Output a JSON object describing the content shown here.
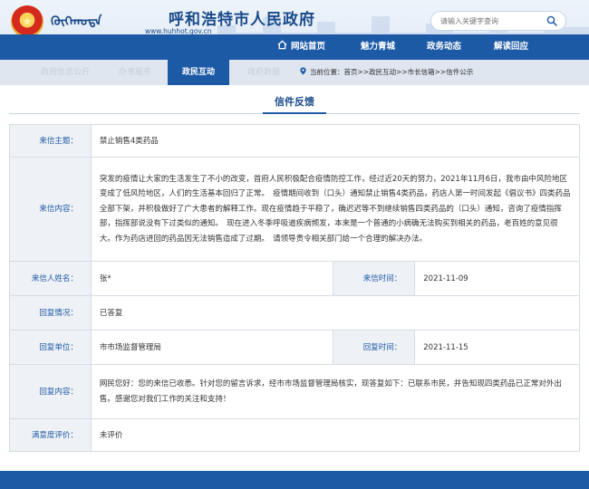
{
  "header": {
    "mongol_script": "ᠬᠥᠬᠡᠬᠣᠲᠠ",
    "site_title": "呼和浩特市人民政府",
    "site_url": "www.huhhot.gov.cn",
    "search_placeholder": "请输入关键字查询",
    "colors": {
      "primary": "#1d5aa6",
      "nav_text": "#ffffff"
    }
  },
  "nav": {
    "items": [
      {
        "label": "网站首页",
        "icon": "home-icon"
      },
      {
        "label": "魅力青城"
      },
      {
        "label": "政务动态"
      },
      {
        "label": "解读回应"
      }
    ]
  },
  "subnav": {
    "tabs": [
      {
        "label": "政府信息公开"
      },
      {
        "label": "办事服务"
      },
      {
        "label": "政民互动"
      },
      {
        "label": "政府数据"
      }
    ],
    "active_index": 2,
    "breadcrumb": "当前位置：首页>>政民互动>>市长信箱>>信件公示"
  },
  "section": {
    "title": "信件反馈"
  },
  "letter": {
    "subject_label": "来信主题：",
    "subject": "禁止销售4类药品",
    "content_label": "来信内容：",
    "content": "突发的疫情让大家的生活发生了不小的改变，首府人民积极配合疫情防控工作，经过近20天的努力，2021年11月6日，我市由中风险地区变成了低风险地区，人们的生活基本回归了正常。　疫情期间收到（口头）通知禁止销售4类药品，药店人第一时间发起《倡议书》四类药品全部下架，并积极做好了广大患者的解释工作。现在疫情趋于平稳了，确迟迟等不到继续销售四类药品的（口头）通知，咨询了疫情指挥部，指挥部说没有下过类似的通知。　现在进入冬季呼吸道疾病频发，本来是一个普通的小病确无法购买到相关的药品，老百姓的意见很大。作为药店进回的药品因无法销售造成了过期。　请领导责令相关部门给一个合理的解决办法。",
    "sender_label": "来信人姓名：",
    "sender": "张*",
    "date_label": "来信时间：",
    "date": "2021-11-09",
    "status_label": "回复情况：",
    "status": "已答复",
    "reply_unit_label": "回复单位：",
    "reply_unit": "市市场监督管理局",
    "reply_date_label": "回复时间：",
    "reply_date": "2021-11-15",
    "reply_label": "回复内容：",
    "reply": "网民您好：您的来信已收悉。针对您的留言诉求，经市市场监督管理局核实，现答复如下：已联系市民，并告知现四类药品已正常对外出售。感谢您对我们工作的关注和支持！",
    "rating_label": "满意度评价：",
    "rating": "未评价"
  }
}
